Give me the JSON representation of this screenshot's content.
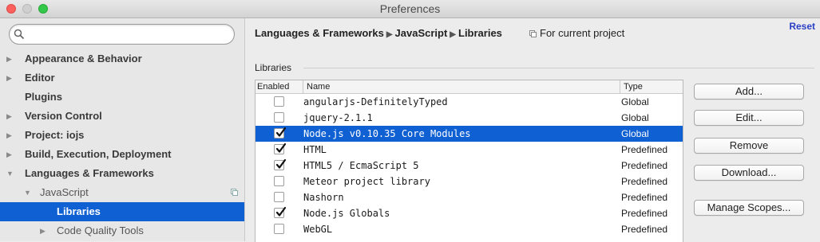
{
  "window": {
    "title": "Preferences"
  },
  "search": {
    "placeholder": "",
    "value": ""
  },
  "sidebar": {
    "items": [
      {
        "label": "Appearance & Behavior",
        "expanded": false
      },
      {
        "label": "Editor",
        "expanded": false
      },
      {
        "label": "Plugins"
      },
      {
        "label": "Version Control",
        "expanded": false
      },
      {
        "label": "Project: iojs",
        "expanded": false
      },
      {
        "label": "Build, Execution, Deployment",
        "expanded": false
      },
      {
        "label": "Languages & Frameworks",
        "expanded": true
      },
      {
        "label": "JavaScript",
        "expanded": true
      },
      {
        "label": "Libraries",
        "selected": true
      },
      {
        "label": "Code Quality Tools",
        "expanded": false
      }
    ]
  },
  "breadcrumb": {
    "parts": [
      "Languages & Frameworks",
      "JavaScript",
      "Libraries"
    ]
  },
  "scope": {
    "label": "For current project"
  },
  "reset": {
    "label": "Reset"
  },
  "libraries": {
    "section_label": "Libraries",
    "columns": [
      "Enabled",
      "Name",
      "Type"
    ],
    "rows": [
      {
        "enabled": false,
        "name": "angularjs-DefinitelyTyped",
        "type": "Global"
      },
      {
        "enabled": false,
        "name": "jquery-2.1.1",
        "type": "Global"
      },
      {
        "enabled": true,
        "name": "Node.js v0.10.35 Core Modules",
        "type": "Global",
        "selected": true
      },
      {
        "enabled": true,
        "name": "HTML",
        "type": "Predefined"
      },
      {
        "enabled": true,
        "name": "HTML5 / EcmaScript 5",
        "type": "Predefined"
      },
      {
        "enabled": false,
        "name": "Meteor project library",
        "type": "Predefined"
      },
      {
        "enabled": false,
        "name": "Nashorn",
        "type": "Predefined"
      },
      {
        "enabled": true,
        "name": "Node.js Globals",
        "type": "Predefined"
      },
      {
        "enabled": false,
        "name": "WebGL",
        "type": "Predefined"
      }
    ]
  },
  "buttons": {
    "add": "Add...",
    "edit": "Edit...",
    "remove": "Remove",
    "download": "Download...",
    "manage_scopes": "Manage Scopes..."
  },
  "colors": {
    "selection": "#0f60d2",
    "reset_link": "#2b3fc5"
  }
}
